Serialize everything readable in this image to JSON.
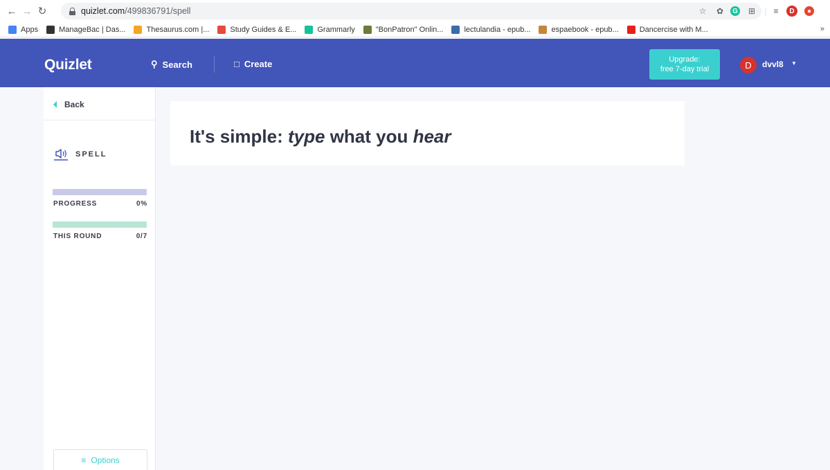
{
  "browser": {
    "url_host": "quizlet.com",
    "url_path": "/499836791/spell",
    "bookmarks": [
      {
        "label": "Apps",
        "color": "#4285f4",
        "icon": "apps-grid-icon"
      },
      {
        "label": "ManageBac | Das...",
        "color": "#333333",
        "icon": "managebac-icon"
      },
      {
        "label": "Thesaurus.com |...",
        "color": "#f4a623",
        "icon": "thesaurus-icon"
      },
      {
        "label": "Study Guides & E...",
        "color": "#e34b3d",
        "icon": "aplus-icon"
      },
      {
        "label": "Grammarly",
        "color": "#15c39a",
        "icon": "grammarly-icon"
      },
      {
        "label": "\"BonPatron\" Onlin...",
        "color": "#6b7b3a",
        "icon": "bonpatron-icon"
      },
      {
        "label": "lectulandia - epub...",
        "color": "#3a6ea5",
        "icon": "lectulandia-icon"
      },
      {
        "label": "espaebook - epub...",
        "color": "#c8853a",
        "icon": "espaebook-icon"
      },
      {
        "label": "Dancercise with M...",
        "color": "#e62117",
        "icon": "youtube-icon"
      }
    ],
    "more": "»",
    "profile_initial": "D"
  },
  "header": {
    "logo": "Quizlet",
    "search_label": "Search",
    "create_label": "Create",
    "upgrade_line1": "Upgrade:",
    "upgrade_line2": "free 7-day trial",
    "avatar_initial": "D",
    "username": "dvvl8",
    "brand_color": "#4255b8",
    "accent_color": "#3ccfcf"
  },
  "sidebar": {
    "back_label": "Back",
    "mode_label": "SPELL",
    "progress_label": "PROGRESS",
    "progress_value": "0%",
    "progress_fraction": 0,
    "round_label": "THIS ROUND",
    "round_value": "0/7",
    "options_label": "Options"
  },
  "main": {
    "prompt_part1": "It's simple: ",
    "prompt_type": "type",
    "prompt_part2": " what you ",
    "prompt_hear": "hear"
  }
}
